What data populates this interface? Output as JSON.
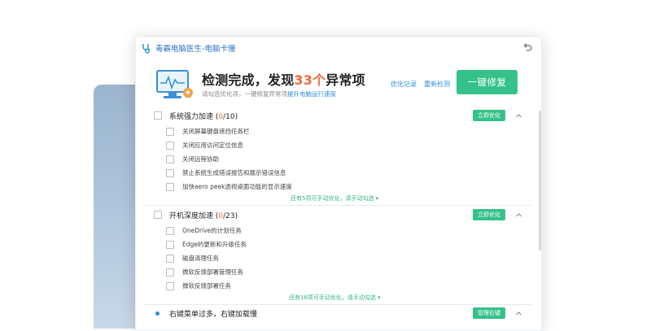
{
  "app": {
    "title": "毒霸电脑医生-电脑卡慢",
    "icon": "stethoscope-icon",
    "back_icon": "back-arrow-icon"
  },
  "header": {
    "title_prefix": "检测完成，发现",
    "issue_count": "33个",
    "title_suffix": "异常项",
    "subtitle_prefix": "请勾选优化项，一键修复异常项",
    "subtitle_highlight": "提升电脑运行速度",
    "link_optimize_log": "优化记录",
    "link_rescan": "重新检测",
    "fix_button": "一键修复"
  },
  "colors": {
    "accent_green": "#35c28a",
    "accent_blue": "#2b8ddb",
    "count_orange": "#f26a3a"
  },
  "sections": [
    {
      "title": "系统强力加速",
      "count_open": "(",
      "count": "0",
      "count_close": "/10)",
      "button": "立即优化",
      "items": [
        "关闭屏幕键盘遮挡任务栏",
        "关闭应用访问定位信息",
        "关闭远程协助",
        "禁止系统生成错误报告和展示错误信息",
        "加快aero peek透视桌面功能的显示速度"
      ],
      "hint": "还有5项可手动优化，请手动勾选 ▾"
    },
    {
      "title": "开机深度加速",
      "count_open": "(",
      "count": "0",
      "count_close": "/23)",
      "button": "立即优化",
      "items": [
        "OneDrive的计划任务",
        "Edge的更新和升级任务",
        "磁盘清理任务",
        "微软反馈部署管理任务",
        "微软反馈部署任务"
      ],
      "hint": "还有18项可手动优化，请手动勾选 ▾"
    },
    {
      "title": "右键菜单过多，右键加载慢",
      "button": "管理右键"
    }
  ]
}
